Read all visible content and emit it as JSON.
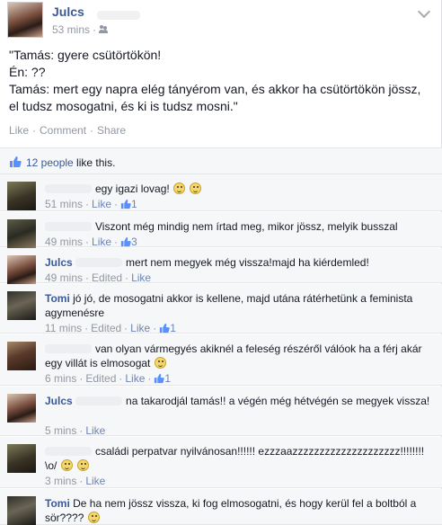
{
  "post": {
    "author": "Julcs",
    "time": "53 mins",
    "audience_icon": "friends-icon",
    "body_lines": [
      "\"Tamás: gyere csütörtökön!",
      "Én: ??",
      "Tamás: mert egy napra elég tányérom van, és akkor ha csütörtökön jössz,",
      "el tudsz mosogatni, és ki is tudsz mosni.\""
    ],
    "actions": {
      "like": "Like",
      "comment": "Comment",
      "share": "Share",
      "sep": "·"
    },
    "likes_text_link": "12 people",
    "likes_text_rest": " like this."
  },
  "comments": [
    {
      "name": "",
      "text": "egy igazi lovag!",
      "emoticons": 2,
      "time": "51 mins",
      "edited": "",
      "like": "Like",
      "likes": "1",
      "avatar": "dark-man"
    },
    {
      "name": "",
      "text": "Viszont még mindig nem írtad meg, mikor jössz, melyik busszal",
      "emoticons": 0,
      "time": "49 mins",
      "edited": "",
      "like": "Like",
      "likes": "3",
      "avatar": "man-outdoor"
    },
    {
      "name": "Julcs",
      "text": "mert nem megyek még vissza!majd ha kiérdemled!",
      "emoticons": 0,
      "time": "49 mins",
      "edited": "Edited",
      "like": "Like",
      "likes": "",
      "avatar": "julcs"
    },
    {
      "name": "Tomi",
      "text": "jó jó, de mosogatni akkor is kellene, majd utána rátérhetünk a feminista agymenésre",
      "emoticons": 0,
      "time": "11 mins",
      "edited": "Edited",
      "like": "Like",
      "likes": "1",
      "avatar": "tomi"
    },
    {
      "name": "",
      "text": "van olyan vármegyés akiknél a feleség részéről válóok ha a férj akár egy villát is elmosogat",
      "emoticons": 1,
      "time": "6 mins",
      "edited": "Edited",
      "like": "Like",
      "likes": "1",
      "avatar": "woman"
    },
    {
      "name": "Julcs",
      "text": "na takarodjál tamás!! a végén még hétvégén se megyek vissza!",
      "emoticons": 0,
      "time": "5 mins",
      "edited": "",
      "like": "Like",
      "likes": "",
      "avatar": "julcs"
    },
    {
      "name": "",
      "text": "családi perpatvar nyilvánosan!!!!!! ezzzaazzzzzzzzzzzzzzzzzzzz!!!!!!!! \\o/",
      "emoticons": 2,
      "time": "3 mins",
      "edited": "",
      "like": "Like",
      "likes": "",
      "avatar": "dark-man"
    },
    {
      "name": "Tomi",
      "text": "De ha nem jössz vissza, ki fog elmosogatni, és hogy kerül fel a boltból a sör????",
      "emoticons": 1,
      "time": "",
      "edited": "",
      "like": "",
      "likes": "",
      "avatar": "tomi"
    }
  ],
  "colors": {
    "link": "#3b5998",
    "muted": "#9197a3",
    "bg_comment": "#f6f7f8"
  }
}
